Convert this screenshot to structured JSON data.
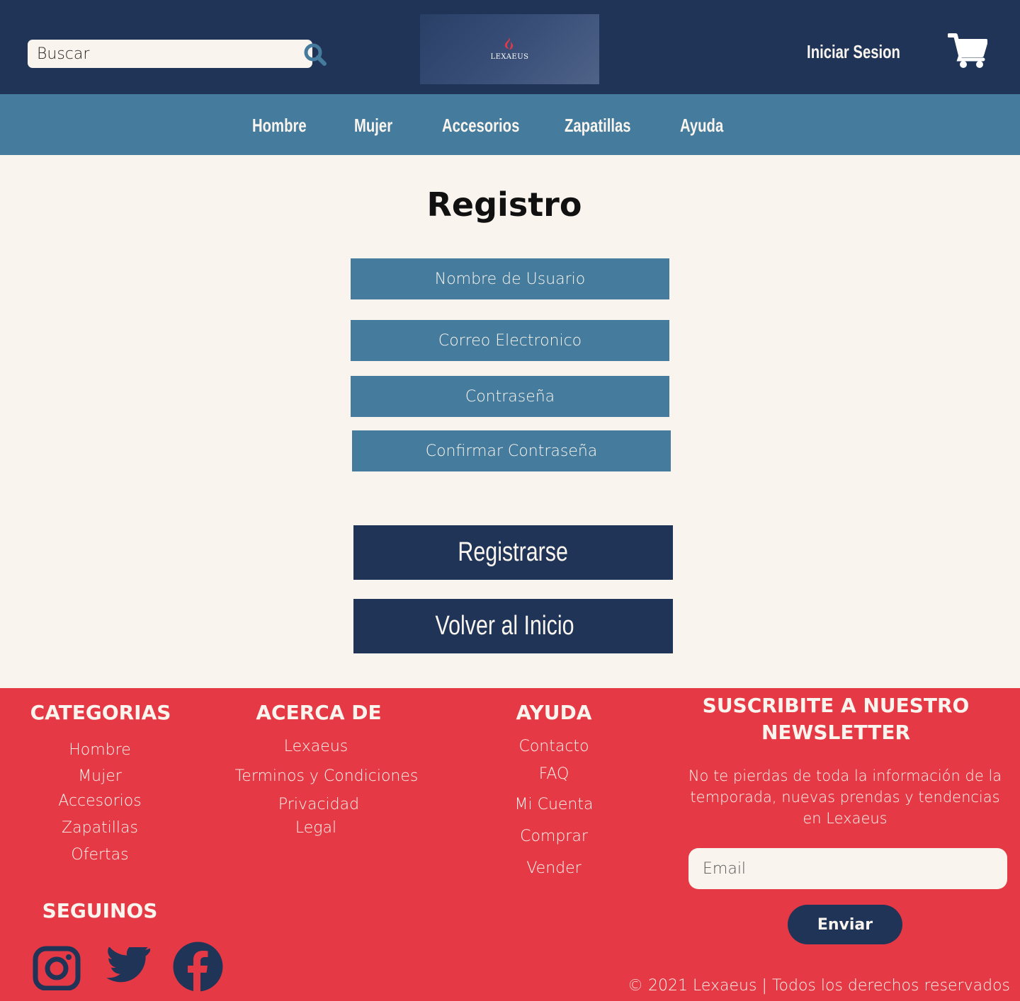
{
  "header": {
    "search_placeholder": "Buscar",
    "logo_text": "LEXAEUS",
    "login_label": "Iniciar Sesion"
  },
  "nav": {
    "items": [
      "Hombre",
      "Mujer",
      "Accesorios",
      "Zapatillas",
      "Ayuda"
    ]
  },
  "main": {
    "title": "Registro",
    "fields": {
      "username_placeholder": "Nombre de Usuario",
      "email_placeholder": "Correo Electronico",
      "password_placeholder": "Contraseña",
      "confirm_placeholder": "Confirmar Contraseña"
    },
    "register_label": "Registrarse",
    "back_label": "Volver al Inicio"
  },
  "footer": {
    "categorias": {
      "title": "CATEGORIAS",
      "links": [
        "Hombre",
        "Mujer",
        "Accesorios",
        "Zapatillas",
        "Ofertas"
      ]
    },
    "acerca": {
      "title": "ACERCA DE",
      "links": [
        "Lexaeus",
        "Terminos y Condiciones",
        "Privacidad",
        "Legal"
      ]
    },
    "ayuda": {
      "title": "AYUDA",
      "links": [
        "Contacto",
        "FAQ",
        "Mi Cuenta",
        "Comprar",
        "Vender"
      ]
    },
    "newsletter": {
      "title_line1": "SUSCRIBITE A NUESTRO",
      "title_line2": "NEWSLETTER",
      "text": "No te pierdas de toda la información de la temporada, nuevas prendas y tendencias en Lexaeus",
      "email_placeholder": "Email",
      "send_label": "Enviar"
    },
    "social": {
      "title": "SEGUINOS",
      "icons": [
        "instagram-icon",
        "twitter-icon",
        "facebook-icon"
      ]
    },
    "copyright": "© 2021 Lexaeus | Todos los derechos reservados"
  },
  "colors": {
    "navy": "#1f3457",
    "steel_blue": "#457b9d",
    "red": "#e63946",
    "cream": "#f9f5ee"
  }
}
